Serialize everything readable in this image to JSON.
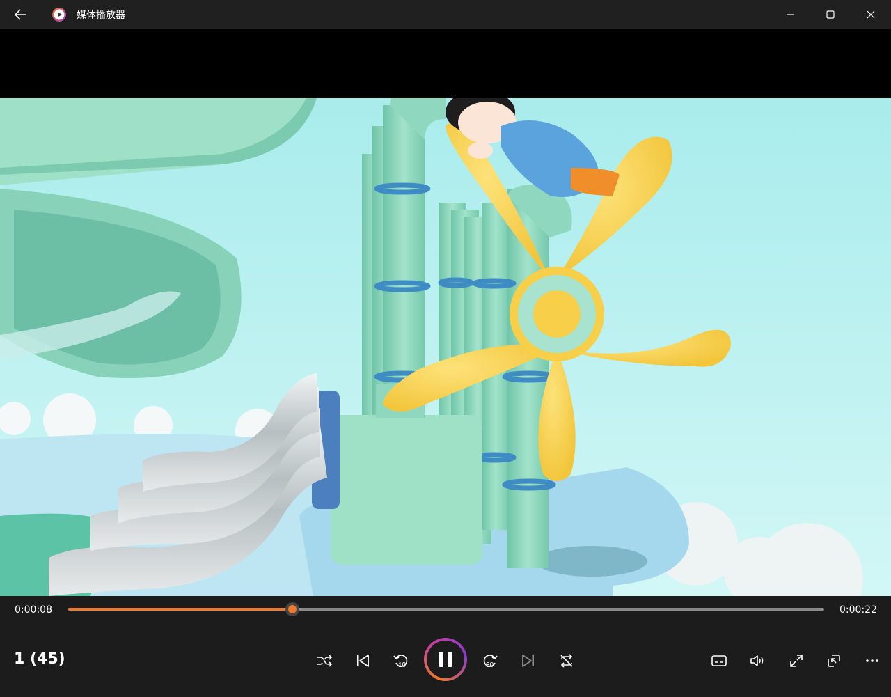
{
  "titlebar": {
    "title": "媒体播放器",
    "icons": [
      "back-arrow-icon",
      "media-player-logo-icon",
      "minimize-icon",
      "maximize-icon",
      "close-icon"
    ]
  },
  "video": {
    "letterbox_color": "#000000",
    "scene_colors": {
      "sky": "#b6eff0",
      "pipe": "#8fd8bf",
      "propeller": "#f7cf48",
      "platform": "#a6d9ee"
    }
  },
  "playback": {
    "current_time": "0:00:08",
    "total_time": "0:00:22",
    "progress": 0.2965,
    "accent_color": "#f07a2c"
  },
  "playlist": {
    "position_label": "1 (45)"
  },
  "controls": {
    "center": [
      "shuffle-icon",
      "previous-icon",
      "skip-back-10-icon",
      "pause-icon",
      "skip-forward-30-icon",
      "next-icon",
      "repeat-icon"
    ],
    "skip_back_label": "10",
    "skip_forward_label": "30",
    "right": [
      "subtitles-icon",
      "volume-icon",
      "fullscreen-icon",
      "mini-player-icon",
      "more-icon"
    ]
  }
}
